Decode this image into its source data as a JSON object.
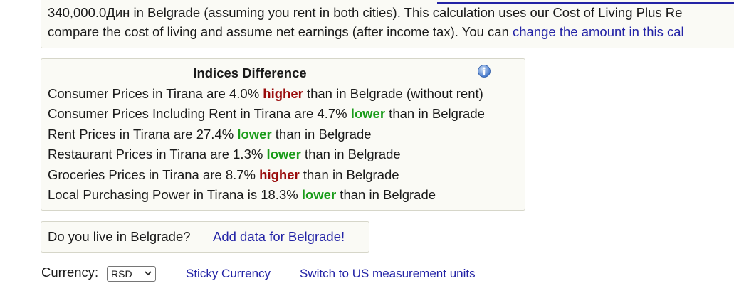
{
  "top_box": {
    "line1_start": "340,000.0Дин in Belgrade (assuming you rent in both cities). This calculation uses our Cost of Living Plus Re",
    "line2_start": "compare the cost of living and assume net earnings (after income tax). You can ",
    "line2_link": "change the amount in this cal"
  },
  "indices": {
    "title": "Indices Difference",
    "rows": [
      {
        "prefix": "Consumer Prices in Tirana are 4.0% ",
        "word": "higher",
        "suffix": " than in Belgrade (without rent)"
      },
      {
        "prefix": "Consumer Prices Including Rent in Tirana are 4.7% ",
        "word": "lower",
        "suffix": " than in Belgrade"
      },
      {
        "prefix": "Rent Prices in Tirana are 27.4% ",
        "word": "lower",
        "suffix": " than in Belgrade"
      },
      {
        "prefix": "Restaurant Prices in Tirana are 1.3% ",
        "word": "lower",
        "suffix": " than in Belgrade"
      },
      {
        "prefix": "Groceries Prices in Tirana are 8.7% ",
        "word": "higher",
        "suffix": " than in Belgrade"
      },
      {
        "prefix": "Local Purchasing Power in Tirana is 18.3% ",
        "word": "lower",
        "suffix": " than in Belgrade"
      }
    ]
  },
  "live": {
    "question": "Do you live in Belgrade?",
    "link": "Add data for Belgrade!"
  },
  "currency": {
    "label": "Currency:",
    "selected": "RSD",
    "sticky_link": "Sticky Currency",
    "units_link": "Switch to US measurement units"
  },
  "colors": {
    "link": "#2323a6",
    "higher": "#9a0c0c",
    "lower": "#1a9c1a",
    "box_bg": "#fafaf5"
  },
  "icons": {
    "info": "info-icon",
    "dropdown": "chevron-down-icon"
  }
}
